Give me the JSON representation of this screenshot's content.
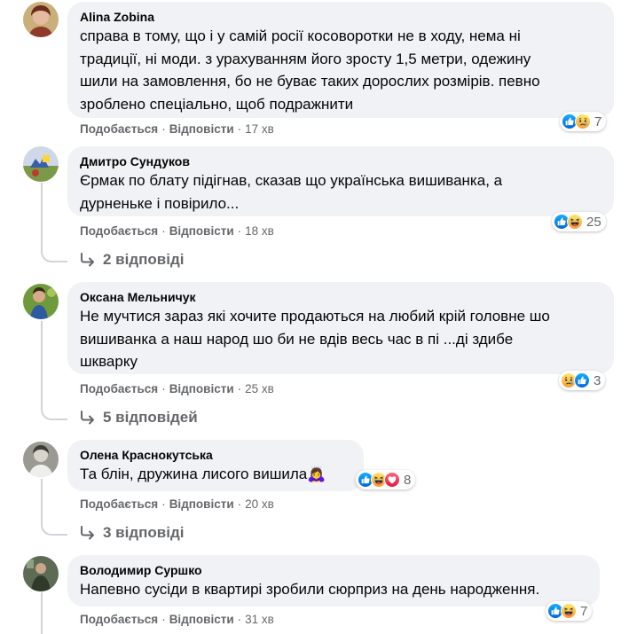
{
  "comments": [
    {
      "author": "Alina Zobina",
      "lines": [
        "справа в тому, що і у самій росії косоворотки не в ходу, нема ні",
        "традиції, ні моди. з урахуванням його зросту 1,5 метри, одежину",
        "шили на замовлення, бо не буває таких дорослих розмірів. певно",
        "зроблено спеціально, щоб подражнити"
      ],
      "like": "Подобається",
      "reply": "Відповісти",
      "time": "17 хв",
      "reactions": [
        "like-icon",
        "sad-icon"
      ],
      "reaction_count": "7"
    },
    {
      "author": "Дмитро Сундуков",
      "lines": [
        "Єрмак по блату підігнав, сказав що українська вишиванка, а",
        "дурненьке і повірило..."
      ],
      "like": "Подобається",
      "reply": "Відповісти",
      "time": "18 хв",
      "reactions": [
        "like-icon",
        "haha-icon"
      ],
      "reaction_count": "25",
      "replies": "2 відповіді"
    },
    {
      "author": "Оксана Мельничук",
      "lines": [
        "Не мучтися зараз які хочите продаються на любий крій головне шо",
        "вишиванка а наш народ шо би не вдів весь час в пі ...ді здибе",
        "шкварку"
      ],
      "like": "Подобається",
      "reply": "Відповісти",
      "time": "25 хв",
      "reactions": [
        "sad-icon",
        "like-icon"
      ],
      "reaction_count": "3",
      "replies": "5 відповідей"
    },
    {
      "author": "Олена Краснокутська",
      "lines": [
        "Та блін, дружина лисого вишила🙇‍♀️"
      ],
      "like": "Подобається",
      "reply": "Відповісти",
      "time": "20 хв",
      "reactions": [
        "like-icon",
        "haha-icon",
        "love-icon"
      ],
      "reaction_count": "8",
      "replies": "3 відповіді"
    },
    {
      "author": "Володимир Суршко",
      "lines": [
        "Напевно сусіди в квартирі зробили сюрприз на день народження."
      ],
      "like": "Подобається",
      "reply": "Відповісти",
      "time": "31 хв",
      "reactions": [
        "like-icon",
        "haha-icon"
      ],
      "reaction_count": "7"
    }
  ],
  "colors": {
    "bubble": "#f0f2f5",
    "meta": "#65676b",
    "like_blue": "#1877f2",
    "reaction_yellow": "#f7b125",
    "love_red": "#f33e58"
  }
}
